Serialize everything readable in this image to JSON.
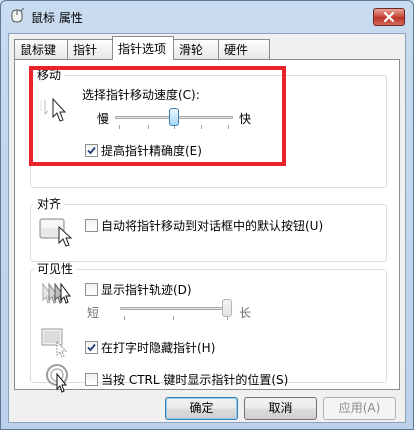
{
  "window": {
    "title": "鼠标 属性"
  },
  "tabs": [
    {
      "label": "鼠标键"
    },
    {
      "label": "指针"
    },
    {
      "label": "指针选项"
    },
    {
      "label": "滑轮"
    },
    {
      "label": "硬件"
    }
  ],
  "motion": {
    "group_label": "移动",
    "speed_label": "选择指针移动速度(C):",
    "slow": "慢",
    "fast": "快",
    "speed_level": 0.5,
    "precision_label": "提高指针精确度(E)",
    "precision_checked": true
  },
  "snap": {
    "group_label": "对齐",
    "label": "自动将指针移动到对话框中的默认按钮(U)",
    "checked": false
  },
  "visibility": {
    "group_label": "可见性",
    "trails_label": "显示指针轨迹(D)",
    "trails_checked": false,
    "short": "短",
    "long": "长",
    "trail_level": 1.0,
    "hide_label": "在打字时隐藏指针(H)",
    "hide_checked": true,
    "ctrl_label": "当按 CTRL 键时显示指针的位置(S)",
    "ctrl_checked": false
  },
  "buttons": {
    "ok": "确定",
    "cancel": "取消",
    "apply": "应用(A)"
  },
  "colors": {
    "highlight": "#e8232a",
    "title_bar": "#c8dbef"
  },
  "icons": {
    "title": "mouse-icon",
    "close": "close-icon",
    "speed": "cursor-speed-icon",
    "snap": "snap-to-default-icon",
    "trails": "pointer-trails-icon",
    "hide": "hide-pointer-icon",
    "ctrl": "locate-pointer-icon"
  }
}
